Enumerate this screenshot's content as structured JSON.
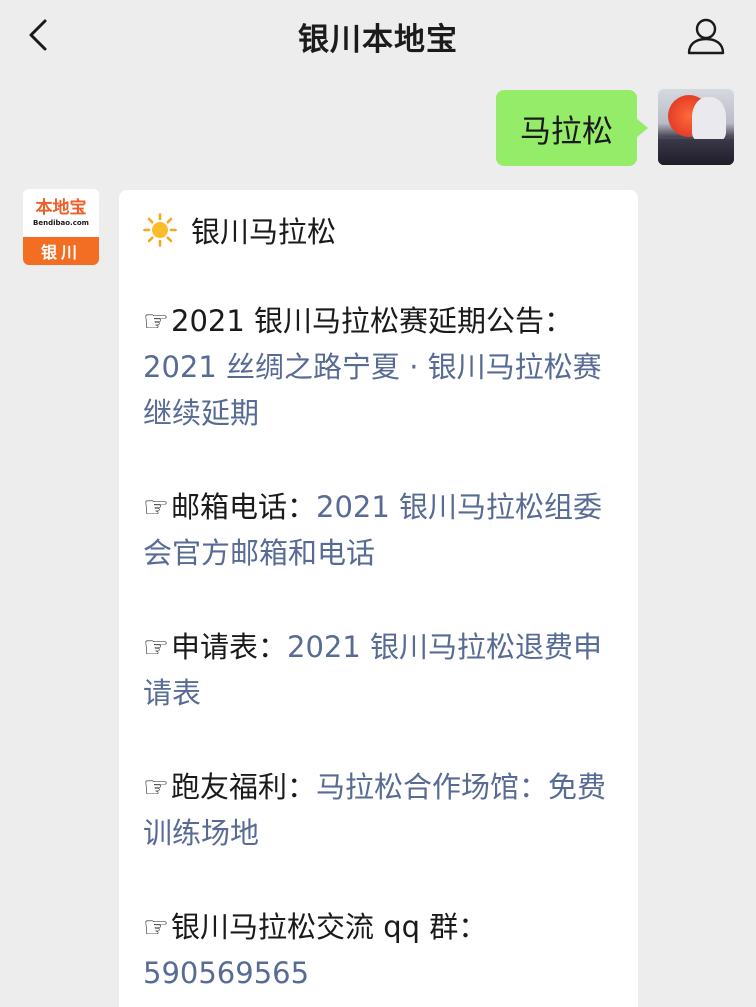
{
  "header": {
    "title": "银川本地宝"
  },
  "outgoing": {
    "text": "马拉松"
  },
  "bot_avatar": {
    "logo_text": "本地宝",
    "logo_url": "Bendibao.com",
    "city": "银川"
  },
  "incoming": {
    "title": "银川马拉松",
    "hand_icon": "☞",
    "items": [
      {
        "label": "2021 银川马拉松赛延期公告：",
        "link": "2021 丝绸之路宁夏 · 银川马拉松赛继续延期"
      },
      {
        "label": "邮箱电话：",
        "link": "2021 银川马拉松组委会官方邮箱和电话"
      },
      {
        "label": "申请表：",
        "link": "2021 银川马拉松退费申请表"
      },
      {
        "label": "跑友福利：",
        "link": "马拉松合作场馆：免费训练场地"
      },
      {
        "label": "银川马拉松交流 qq 群：",
        "link": "590569565"
      }
    ]
  },
  "colors": {
    "background": "#ededed",
    "outgoing_bubble": "#95ec69",
    "incoming_bubble": "#ffffff",
    "link": "#576b95",
    "brand_orange": "#f36d22"
  }
}
